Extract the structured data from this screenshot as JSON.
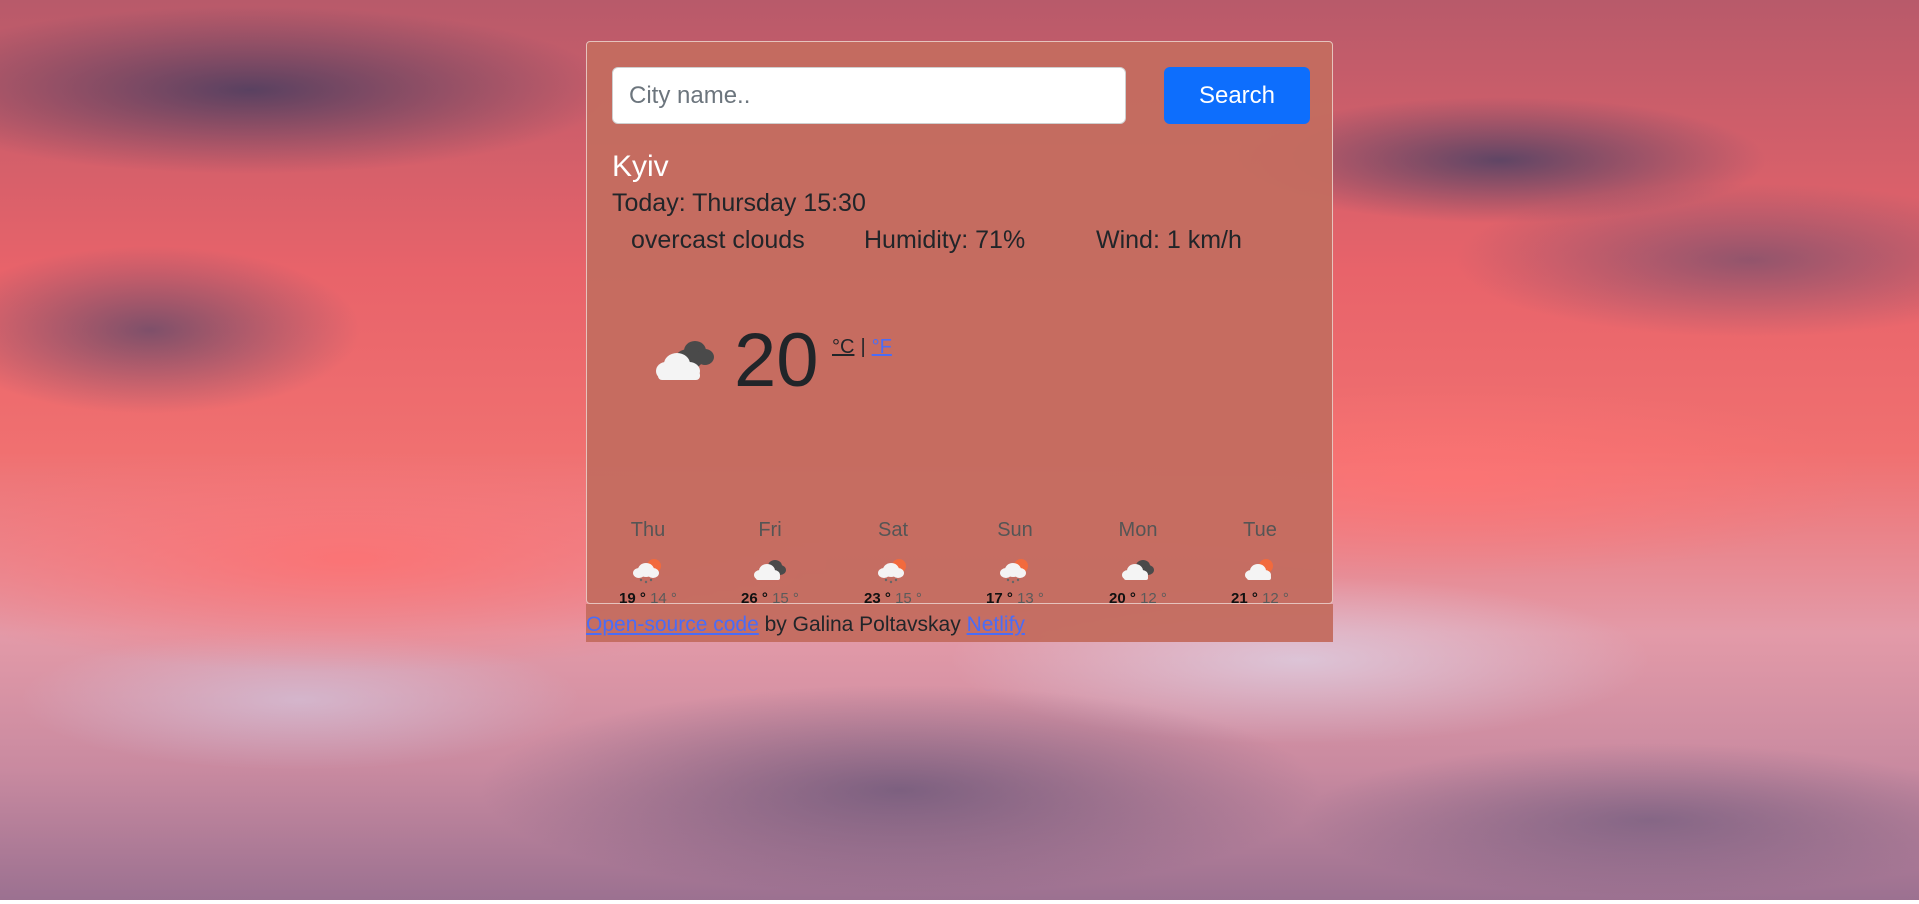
{
  "search": {
    "placeholder": "City name..",
    "button_label": "Search"
  },
  "current": {
    "city": "Kyiv",
    "today": "Today: Thursday 15:30",
    "description": "overcast clouds",
    "humidity": "Humidity: 71%",
    "wind": "Wind: 1 km/h",
    "temperature": "20",
    "unit_celsius": "°C",
    "unit_separator": "|",
    "unit_fahrenheit": "°F",
    "icon": "overcast-clouds-icon"
  },
  "forecast": [
    {
      "day": "Thu",
      "max": "19 °",
      "min": "14 °",
      "icon": "sun-rain-cloud-icon"
    },
    {
      "day": "Fri",
      "max": "26 °",
      "min": "15 °",
      "icon": "broken-clouds-icon"
    },
    {
      "day": "Sat",
      "max": "23 °",
      "min": "15 °",
      "icon": "sun-rain-cloud-icon"
    },
    {
      "day": "Sun",
      "max": "17 °",
      "min": "13 °",
      "icon": "sun-rain-cloud-icon"
    },
    {
      "day": "Mon",
      "max": "20 °",
      "min": "12 °",
      "icon": "broken-clouds-icon"
    },
    {
      "day": "Tue",
      "max": "21 °",
      "min": "12 °",
      "icon": "sun-cloud-icon"
    }
  ],
  "footer": {
    "source_link": "Open-source code",
    "by_text": "by Galina Poltavskay",
    "host_link": "Netlify"
  },
  "colors": {
    "card": "#c46c60",
    "search_button": "#0d6efd",
    "link": "#4a6cf7",
    "city_text": "#ffffff"
  }
}
